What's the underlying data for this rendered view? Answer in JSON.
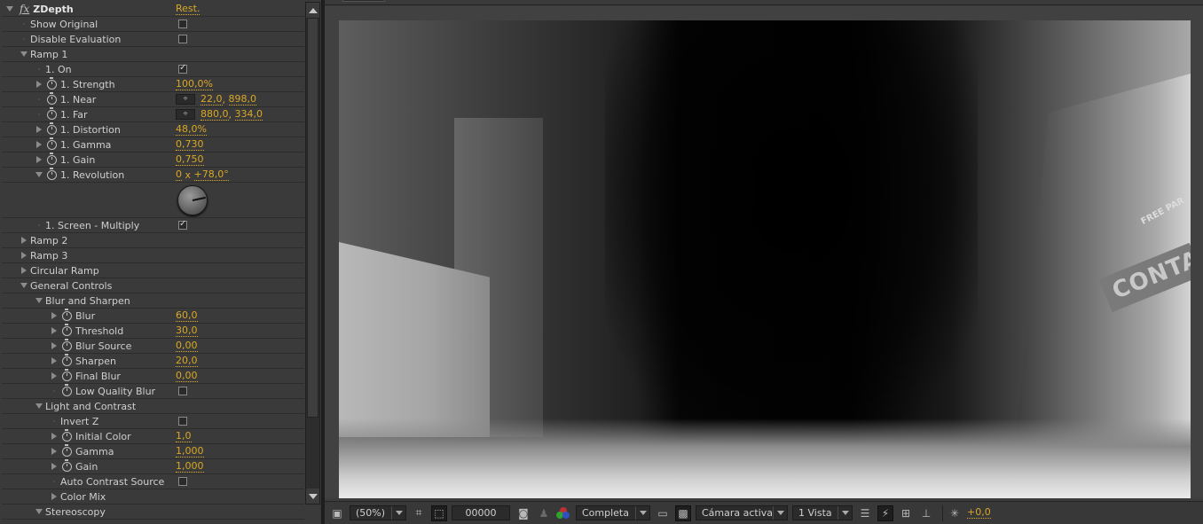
{
  "effect_panel": {
    "effect_name": "ZDepth",
    "fx_glyph": "fx",
    "reset_label": "Rest.",
    "rows": [
      {
        "label": "Show Original",
        "indent": 1,
        "twirl": "none",
        "stopwatch": false,
        "type": "checkbox",
        "checked": false
      },
      {
        "label": "Disable Evaluation",
        "indent": 1,
        "twirl": "none",
        "stopwatch": false,
        "type": "checkbox",
        "checked": false
      },
      {
        "label": "Ramp 1",
        "indent": 1,
        "twirl": "open",
        "stopwatch": false,
        "type": "group"
      },
      {
        "label": "1. On",
        "indent": 2,
        "twirl": "none",
        "stopwatch": false,
        "type": "checkbox",
        "checked": true
      },
      {
        "label": "1. Strength",
        "indent": 2,
        "twirl": "closed",
        "stopwatch": true,
        "type": "value",
        "value": "100,0%"
      },
      {
        "label": "1. Near",
        "indent": 2,
        "twirl": "none",
        "stopwatch": true,
        "type": "point",
        "x": "22,0",
        "y": "898,0"
      },
      {
        "label": "1. Far",
        "indent": 2,
        "twirl": "none",
        "stopwatch": true,
        "type": "point",
        "x": "880,0",
        "y": "334,0"
      },
      {
        "label": "1. Distortion",
        "indent": 2,
        "twirl": "closed",
        "stopwatch": true,
        "type": "value",
        "value": "48,0%"
      },
      {
        "label": "1. Gamma",
        "indent": 2,
        "twirl": "closed",
        "stopwatch": true,
        "type": "value",
        "value": "0,730"
      },
      {
        "label": "1. Gain",
        "indent": 2,
        "twirl": "closed",
        "stopwatch": true,
        "type": "value",
        "value": "0,750"
      },
      {
        "label": "1. Revolution",
        "indent": 2,
        "twirl": "open",
        "stopwatch": true,
        "type": "angle",
        "revolutions": "0",
        "degrees": "+78,0°"
      },
      {
        "label": "",
        "type": "dial"
      },
      {
        "label": "1. Screen - Multiply",
        "indent": 2,
        "twirl": "none",
        "stopwatch": false,
        "type": "checkbox",
        "checked": true
      },
      {
        "label": "Ramp 2",
        "indent": 1,
        "twirl": "closed",
        "stopwatch": false,
        "type": "group"
      },
      {
        "label": "Ramp 3",
        "indent": 1,
        "twirl": "closed",
        "stopwatch": false,
        "type": "group"
      },
      {
        "label": "Circular Ramp",
        "indent": 1,
        "twirl": "closed",
        "stopwatch": false,
        "type": "group"
      },
      {
        "label": "General Controls",
        "indent": 1,
        "twirl": "open",
        "stopwatch": false,
        "type": "group"
      },
      {
        "label": "Blur and Sharpen",
        "indent": 2,
        "twirl": "open",
        "stopwatch": false,
        "type": "group"
      },
      {
        "label": "Blur",
        "indent": 3,
        "twirl": "closed",
        "stopwatch": true,
        "type": "value",
        "value": "60,0"
      },
      {
        "label": "Threshold",
        "indent": 3,
        "twirl": "closed",
        "stopwatch": true,
        "type": "value",
        "value": "30,0"
      },
      {
        "label": "Blur Source",
        "indent": 3,
        "twirl": "closed",
        "stopwatch": true,
        "type": "value",
        "value": "0,00"
      },
      {
        "label": "Sharpen",
        "indent": 3,
        "twirl": "closed",
        "stopwatch": true,
        "type": "value",
        "value": "20,0"
      },
      {
        "label": "Final Blur",
        "indent": 3,
        "twirl": "closed",
        "stopwatch": true,
        "type": "value",
        "value": "0,00"
      },
      {
        "label": "Low Quality Blur",
        "indent": 3,
        "twirl": "none",
        "stopwatch": true,
        "type": "checkbox",
        "checked": false
      },
      {
        "label": "Light and Contrast",
        "indent": 2,
        "twirl": "open",
        "stopwatch": false,
        "type": "group"
      },
      {
        "label": "Invert Z",
        "indent": 3,
        "twirl": "none",
        "stopwatch": false,
        "type": "checkbox",
        "checked": false
      },
      {
        "label": "Initial Color",
        "indent": 3,
        "twirl": "closed",
        "stopwatch": true,
        "type": "value",
        "value": "1,0"
      },
      {
        "label": "Gamma",
        "indent": 3,
        "twirl": "closed",
        "stopwatch": true,
        "type": "value",
        "value": "1,000"
      },
      {
        "label": "Gain",
        "indent": 3,
        "twirl": "closed",
        "stopwatch": true,
        "type": "value",
        "value": "1,000"
      },
      {
        "label": "Auto Contrast Source",
        "indent": 3,
        "twirl": "none",
        "stopwatch": false,
        "type": "checkbox",
        "checked": false
      },
      {
        "label": "Color Mix",
        "indent": 3,
        "twirl": "closed",
        "stopwatch": false,
        "type": "group"
      },
      {
        "label": "Stereoscopy",
        "indent": 2,
        "twirl": "open",
        "stopwatch": false,
        "type": "group"
      }
    ],
    "scrollbar": {
      "position_fraction": 0.0,
      "visible_fraction": 0.85
    }
  },
  "viewer": {
    "image_text": {
      "sign_main": "CONTA",
      "sign_small": "FREE PAR"
    },
    "toolbar": {
      "magnification": "(50%)",
      "timecode": "00000",
      "resolution": "Completa",
      "camera": "Cámara activa",
      "views": "1 Vista",
      "exposure": "+0,0"
    }
  },
  "colors": {
    "value_accent": "#d9a826",
    "panel_bg": "#3a3a3a",
    "viewer_bg": "#414141"
  }
}
